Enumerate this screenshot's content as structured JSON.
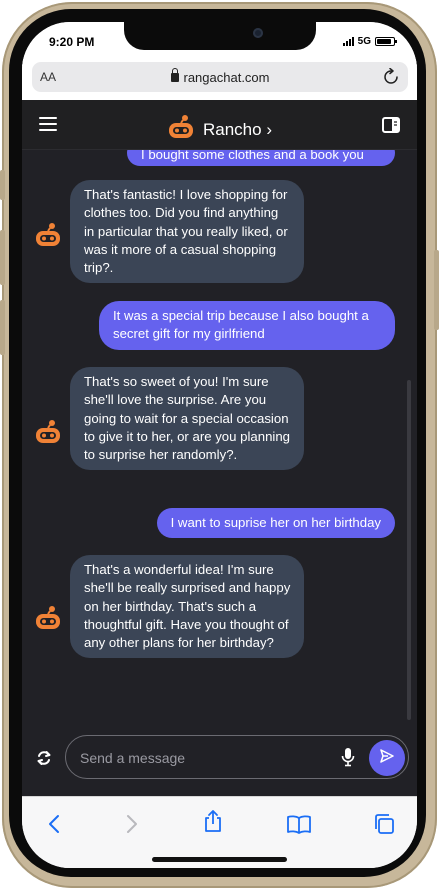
{
  "status_bar": {
    "time": "9:20 PM",
    "network": "5G",
    "battery_level": 0.85
  },
  "browser": {
    "text_size_label": "AA",
    "url": "rangachat.com"
  },
  "app": {
    "bot_name": "Rancho",
    "bot_name_chevron": "›",
    "colors": {
      "background": "#212126",
      "bot_bubble": "#3b4556",
      "user_bubble": "#6562ee",
      "avatar": "#f08236"
    }
  },
  "messages": [
    {
      "sender": "user",
      "text": "I bought some clothes and a book you"
    },
    {
      "sender": "bot",
      "text": "That's fantastic! I love shopping for clothes too. Did you find anything in particular that you really liked, or was it more of a casual shopping trip?."
    },
    {
      "sender": "user",
      "text": "It was a special trip because I also bought a secret gift for my girlfriend"
    },
    {
      "sender": "bot",
      "text": "That's so sweet of you! I'm sure she'll love the surprise. Are you going to wait for a special occasion to give it to her, or are you planning to surprise her randomly?."
    },
    {
      "sender": "user",
      "text": "I want to suprise her on her birthday"
    },
    {
      "sender": "bot",
      "text": "That's a wonderful idea! I'm sure she'll be really surprised and happy on her birthday. That's such a thoughtful gift. Have you thought of any other plans for her birthday?"
    }
  ],
  "composer": {
    "placeholder": "Send a message",
    "value": ""
  },
  "icons": {
    "menu": "hamburger-icon",
    "panel": "side-panel-icon",
    "refresh": "refresh-icon",
    "mic": "microphone-icon",
    "send": "send-icon",
    "back": "back-chevron-icon",
    "forward": "forward-chevron-icon",
    "share": "share-icon",
    "bookmarks": "bookmarks-icon",
    "tabs": "tabs-icon"
  }
}
